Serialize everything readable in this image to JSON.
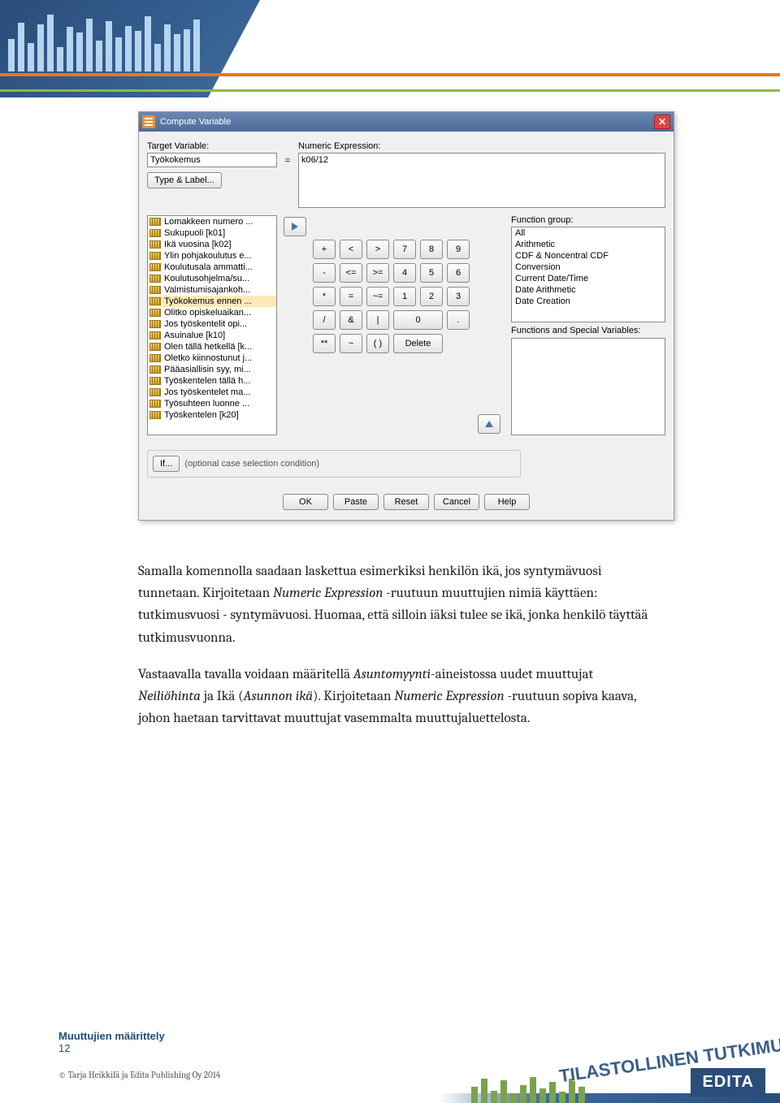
{
  "dialog": {
    "title": "Compute Variable",
    "target_label": "Target Variable:",
    "target_value": "Työkokemus",
    "type_label_btn": "Type & Label...",
    "numeric_label": "Numeric Expression:",
    "numeric_value": "k06/12",
    "variables": [
      "Lomakkeen numero ...",
      "Sukupuoli [k01]",
      "Ikä vuosina [k02]",
      "Ylin pohjakoulutus e...",
      "Koulutusala ammatti...",
      "Koulutusohjelma/su...",
      "Valmistumisajankoh...",
      "Työkokemus ennen ...",
      "Olitko opiskeluaikan...",
      "Jos työskentelit opi...",
      "Asuinalue [k10]",
      "Olen tällä hetkellä [k...",
      "Oletko kiinnostunut j...",
      "Pääasiallisin syy, mi...",
      "Työskentelen tällä h...",
      "Jos työskentelet ma...",
      "Työsuhteen luonne ...",
      "Työskentelen [k20]"
    ],
    "selected_var_index": 7,
    "keypad": {
      "r1": [
        "+",
        "<",
        ">",
        "7",
        "8",
        "9"
      ],
      "r2": [
        "-",
        "<=",
        ">=",
        "4",
        "5",
        "6"
      ],
      "r3": [
        "*",
        "=",
        "~=",
        "1",
        "2",
        "3"
      ],
      "r4": [
        "/",
        "&",
        "|",
        "0",
        "."
      ],
      "r5": [
        "**",
        "~",
        "( )",
        "Delete"
      ]
    },
    "func_group_label": "Function group:",
    "func_groups": [
      "All",
      "Arithmetic",
      "CDF & Noncentral CDF",
      "Conversion",
      "Current Date/Time",
      "Date Arithmetic",
      "Date Creation"
    ],
    "fsv_label": "Functions and Special Variables:",
    "if_btn": "If...",
    "if_text": "(optional case selection condition)",
    "buttons": {
      "ok": "OK",
      "paste": "Paste",
      "reset": "Reset",
      "cancel": "Cancel",
      "help": "Help"
    }
  },
  "body": {
    "p1a": "Samalla komennolla saadaan laskettua esimerkiksi henkilön ikä, jos syntymävuosi tunnetaan. Kirjoitetaan ",
    "p1b": "Numeric Expression",
    "p1c": " -ruutuun muuttujien nimiä käyttäen: tutkimusvuosi - syntymävuosi. Huomaa, että silloin iäksi tulee se ikä, jonka henkilö täyttää tutkimusvuonna.",
    "p2a": "Vastaavalla tavalla voidaan määritellä ",
    "p2b": "Asuntomyynti",
    "p2c": "-aineistossa uudet muuttujat ",
    "p2d": "Neiliöhinta",
    "p2e": " ja Ikä (",
    "p2f": "Asunnon ikä",
    "p2g": "). Kirjoitetaan ",
    "p2h": "Numeric Expression",
    "p2i": " -ruutuun sopiva kaava, johon haetaan tarvittavat muuttujat vasemmalta muuttujaluettelosta."
  },
  "footer": {
    "section": "Muuttujien määrittely",
    "page": "12",
    "copyright": "© Tarja Heikkilä ja Edita Publishing Oy 2014",
    "brand1": "TILASTOLLINEN TUTKIMUS",
    "brand2": "EDITA"
  }
}
